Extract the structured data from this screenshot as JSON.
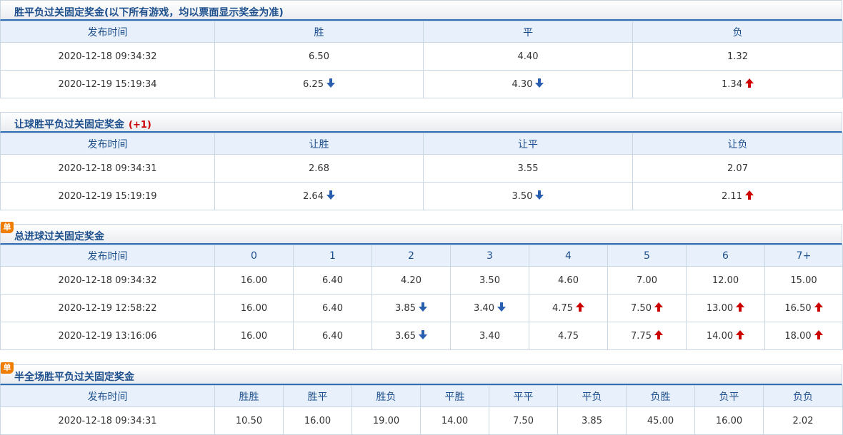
{
  "colors": {
    "title": "#1e4f8d",
    "down": "#2a5fb0",
    "up": "#cc0000",
    "badge": "#f07c00"
  },
  "badge_label": "单",
  "sections": [
    {
      "title": "胜平负过关固定奖金(以下所有游戏，均以票面显示奖金为准)",
      "extra": "",
      "has_badge": false,
      "headers": [
        "发布时间",
        "胜",
        "平",
        "负"
      ],
      "rows": [
        [
          {
            "v": "2020-12-18 09:34:32"
          },
          {
            "v": "6.50"
          },
          {
            "v": "4.40"
          },
          {
            "v": "1.32"
          }
        ],
        [
          {
            "v": "2020-12-19 15:19:34"
          },
          {
            "v": "6.25",
            "t": "down"
          },
          {
            "v": "4.30",
            "t": "down"
          },
          {
            "v": "1.34",
            "t": "up"
          }
        ]
      ]
    },
    {
      "title": "让球胜平负过关固定奖金",
      "extra": "(+1)",
      "has_badge": false,
      "headers": [
        "发布时间",
        "让胜",
        "让平",
        "让负"
      ],
      "rows": [
        [
          {
            "v": "2020-12-18 09:34:31"
          },
          {
            "v": "2.68"
          },
          {
            "v": "3.55"
          },
          {
            "v": "2.07"
          }
        ],
        [
          {
            "v": "2020-12-19 15:19:19"
          },
          {
            "v": "2.64",
            "t": "down"
          },
          {
            "v": "3.50",
            "t": "down"
          },
          {
            "v": "2.11",
            "t": "up"
          }
        ]
      ]
    },
    {
      "title": "总进球过关固定奖金",
      "extra": "",
      "has_badge": true,
      "headers": [
        "发布时间",
        "0",
        "1",
        "2",
        "3",
        "4",
        "5",
        "6",
        "7+"
      ],
      "rows": [
        [
          {
            "v": "2020-12-18 09:34:32"
          },
          {
            "v": "16.00"
          },
          {
            "v": "6.40"
          },
          {
            "v": "4.20"
          },
          {
            "v": "3.50"
          },
          {
            "v": "4.60"
          },
          {
            "v": "7.00"
          },
          {
            "v": "12.00"
          },
          {
            "v": "15.00"
          }
        ],
        [
          {
            "v": "2020-12-19 12:58:22"
          },
          {
            "v": "16.00"
          },
          {
            "v": "6.40"
          },
          {
            "v": "3.85",
            "t": "down"
          },
          {
            "v": "3.40",
            "t": "down"
          },
          {
            "v": "4.75",
            "t": "up"
          },
          {
            "v": "7.50",
            "t": "up"
          },
          {
            "v": "13.00",
            "t": "up"
          },
          {
            "v": "16.50",
            "t": "up"
          }
        ],
        [
          {
            "v": "2020-12-19 13:16:06"
          },
          {
            "v": "16.00"
          },
          {
            "v": "6.40"
          },
          {
            "v": "3.65",
            "t": "down"
          },
          {
            "v": "3.40"
          },
          {
            "v": "4.75"
          },
          {
            "v": "7.75",
            "t": "up"
          },
          {
            "v": "14.00",
            "t": "up"
          },
          {
            "v": "18.00",
            "t": "up"
          }
        ]
      ]
    },
    {
      "title": "半全场胜平负过关固定奖金",
      "extra": "",
      "has_badge": true,
      "headers": [
        "发布时间",
        "胜胜",
        "胜平",
        "胜负",
        "平胜",
        "平平",
        "平负",
        "负胜",
        "负平",
        "负负"
      ],
      "rows": [
        [
          {
            "v": "2020-12-18 09:34:31"
          },
          {
            "v": "10.50"
          },
          {
            "v": "16.00"
          },
          {
            "v": "19.00"
          },
          {
            "v": "14.00"
          },
          {
            "v": "7.50"
          },
          {
            "v": "3.85"
          },
          {
            "v": "45.00"
          },
          {
            "v": "16.00"
          },
          {
            "v": "2.02"
          }
        ]
      ]
    }
  ]
}
